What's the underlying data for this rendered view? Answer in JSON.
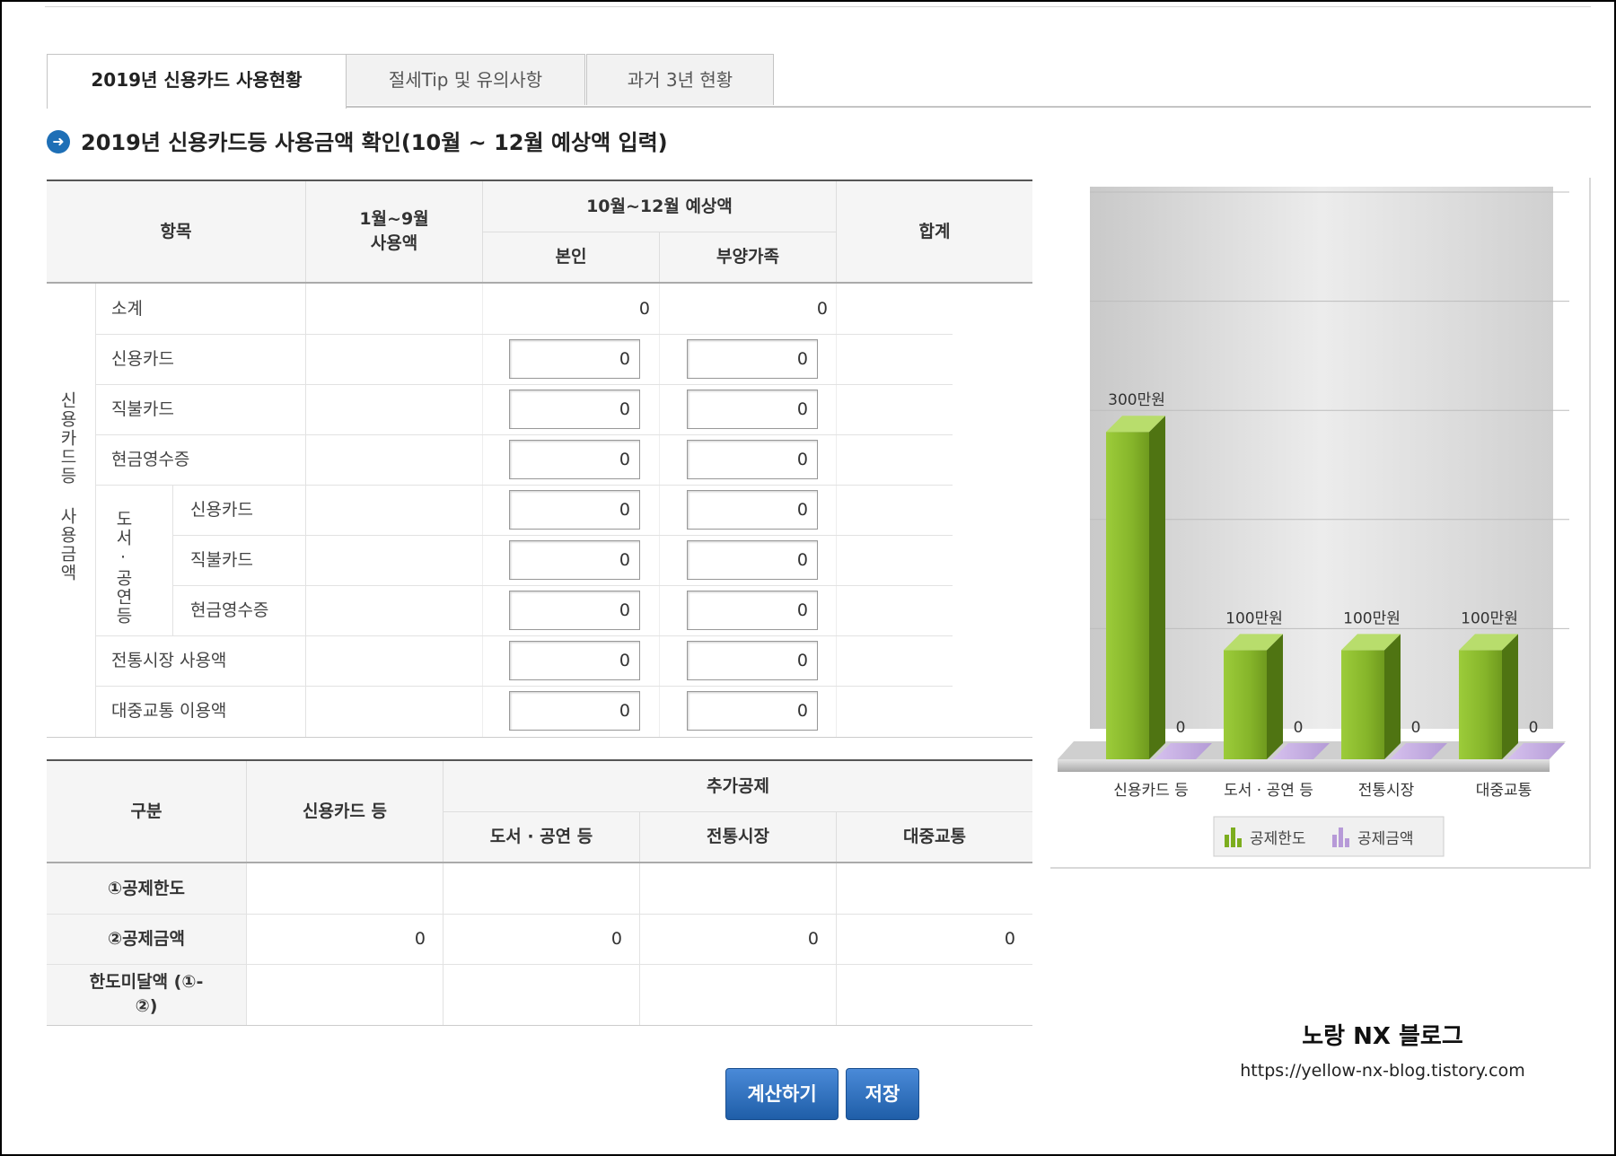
{
  "tabs": [
    {
      "label": "2019년 신용카드 사용현황",
      "active": true
    },
    {
      "label": "절세Tip 및 유의사항",
      "active": false
    },
    {
      "label": "과거 3년 현황",
      "active": false
    }
  ],
  "heading": "2019년 신용카드등 사용금액 확인(10월 ~ 12월 예상액 입력)",
  "usage_table": {
    "headers": {
      "item": "항목",
      "jan_sep": "1월~9월 사용액",
      "oct_dec": "10월~12월 예상액",
      "self": "본인",
      "dependents": "부양가족",
      "total": "합계"
    },
    "group_label": "신용카드등 사용금액",
    "books_group_label": "도서·공연등",
    "subtotal": {
      "label": "소계",
      "self": "0",
      "dependents": "0"
    },
    "rows": [
      {
        "label": "신용카드",
        "self": "0",
        "dependents": "0"
      },
      {
        "label": "직불카드",
        "self": "0",
        "dependents": "0"
      },
      {
        "label": "현금영수증",
        "self": "0",
        "dependents": "0"
      },
      {
        "label": "신용카드",
        "self": "0",
        "dependents": "0"
      },
      {
        "label": "직불카드",
        "self": "0",
        "dependents": "0"
      },
      {
        "label": "현금영수증",
        "self": "0",
        "dependents": "0"
      },
      {
        "label": "전통시장 사용액",
        "self": "0",
        "dependents": "0"
      },
      {
        "label": "대중교통 이용액",
        "self": "0",
        "dependents": "0"
      }
    ]
  },
  "deduction_table": {
    "headers": {
      "category": "구분",
      "credit": "신용카드 등",
      "additional": "추가공제",
      "books": "도서 · 공연 등",
      "market": "전통시장",
      "transit": "대중교통"
    },
    "rows": [
      {
        "label": "①공제한도",
        "values": [
          "",
          "",
          "",
          ""
        ]
      },
      {
        "label": "②공제금액",
        "values": [
          "0",
          "0",
          "0",
          "0"
        ]
      },
      {
        "label": "한도미달액 (①-②)",
        "values": [
          "",
          "",
          "",
          ""
        ]
      }
    ]
  },
  "chart_data": {
    "type": "bar",
    "categories": [
      "신용카드 등",
      "도서 · 공연 등",
      "전통시장",
      "대중교통"
    ],
    "series": [
      {
        "name": "공제한도",
        "values": [
          300,
          100,
          100,
          100
        ],
        "labels": [
          "300만원",
          "100만원",
          "100만원",
          "100만원"
        ],
        "color": "#7cad1e"
      },
      {
        "name": "공제금액",
        "values": [
          0,
          0,
          0,
          0
        ],
        "labels": [
          "0",
          "0",
          "0",
          "0"
        ],
        "color": "#b79ad8"
      }
    ],
    "ylim": [
      0,
      500
    ],
    "grid": true,
    "legend": "bottom"
  },
  "watermark": {
    "title": "노랑 NX 블로그",
    "url": "https://yellow-nx-blog.tistory.com"
  },
  "buttons": {
    "calculate": "계산하기",
    "save": "저장"
  }
}
